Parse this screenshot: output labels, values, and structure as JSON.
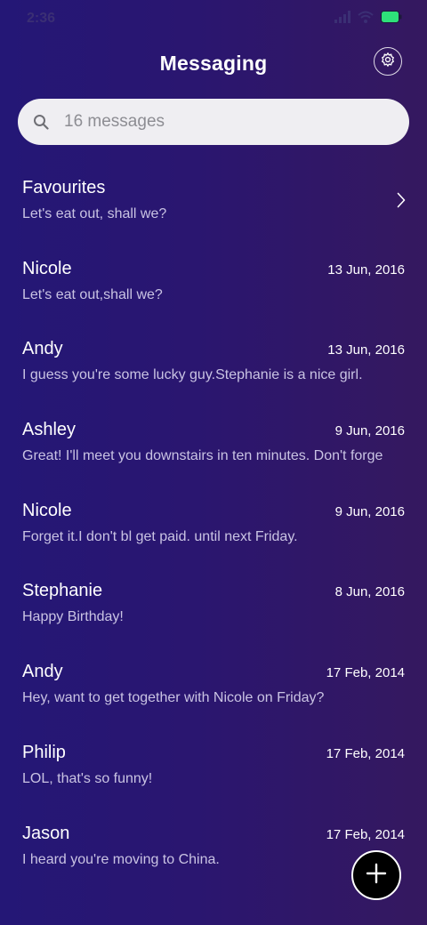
{
  "status_bar": {
    "time": "2:36",
    "battery_color": "#2ee07a"
  },
  "header": {
    "title": "Messaging"
  },
  "search": {
    "placeholder": "16 messages"
  },
  "favourites": {
    "name": "Favourites",
    "preview": "Let's eat out, shall we?"
  },
  "messages": [
    {
      "name": "Nicole",
      "date": "13 Jun, 2016",
      "preview": "Let's eat out,shall we?"
    },
    {
      "name": "Andy",
      "date": "13 Jun, 2016",
      "preview": "I guess you're some lucky guy.Stephanie is a nice girl."
    },
    {
      "name": "Ashley",
      "date": "9 Jun, 2016",
      "preview": "Great! I'll meet you downstairs in ten minutes. Don't forge"
    },
    {
      "name": "Nicole",
      "date": "9 Jun, 2016",
      "preview": "Forget it.I don't bl get paid. until next Friday."
    },
    {
      "name": "Stephanie",
      "date": "8 Jun, 2016",
      "preview": "Happy Birthday!"
    },
    {
      "name": "Andy",
      "date": "17 Feb, 2014",
      "preview": "Hey, want to get together with Nicole on Friday?"
    },
    {
      "name": "Philip",
      "date": "17 Feb, 2014",
      "preview": "LOL, that's so funny!"
    },
    {
      "name": "Jason",
      "date": "17 Feb, 2014",
      "preview": "I heard you're moving to China."
    }
  ],
  "icons": {
    "settings": "gear-icon",
    "search": "search-icon",
    "favourites": "chevron-right-icon",
    "compose": "plus-icon"
  }
}
